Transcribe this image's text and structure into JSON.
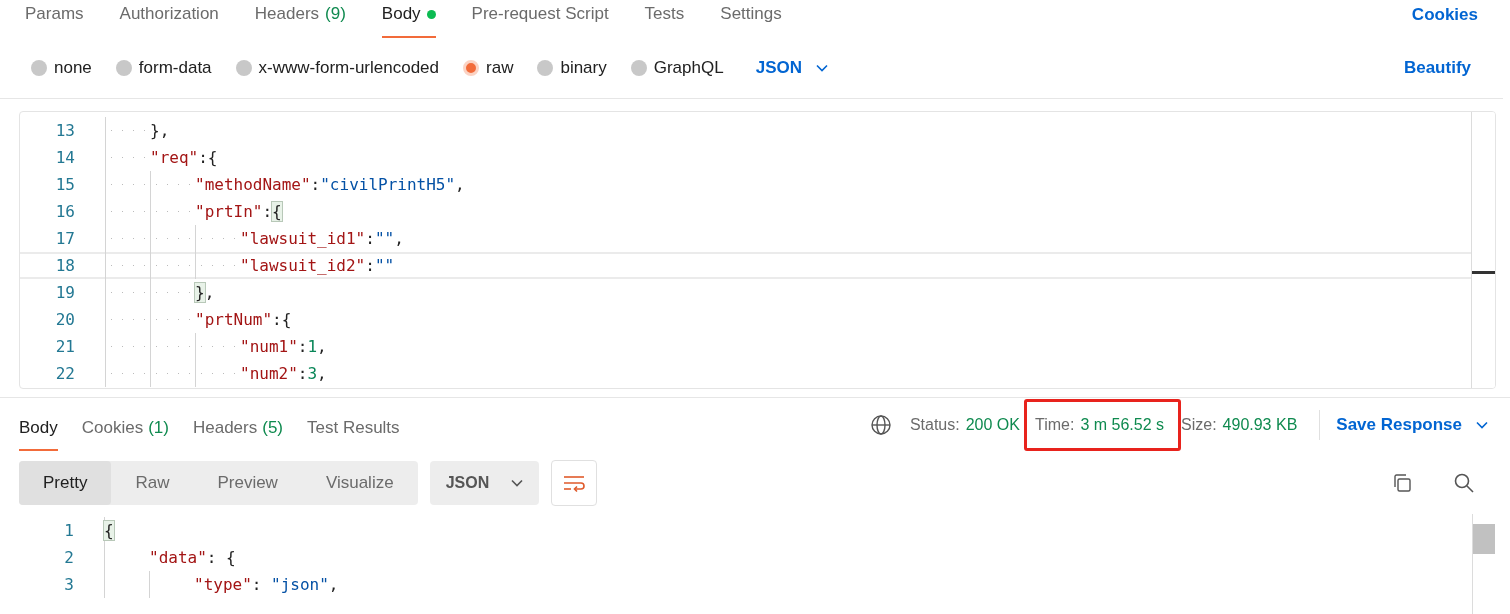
{
  "request_tabs": [
    {
      "label": "Params",
      "selected": false
    },
    {
      "label": "Authorization",
      "selected": false
    },
    {
      "label": "Headers",
      "count": "(9)",
      "selected": false
    },
    {
      "label": "Body",
      "selected": true,
      "indicator": true
    },
    {
      "label": "Pre-request Script",
      "selected": false
    },
    {
      "label": "Tests",
      "selected": false
    },
    {
      "label": "Settings",
      "selected": false
    }
  ],
  "cookies_link": "Cookies",
  "body_types": [
    {
      "label": "none",
      "selected": false
    },
    {
      "label": "form-data",
      "selected": false
    },
    {
      "label": "x-www-form-urlencoded",
      "selected": false
    },
    {
      "label": "raw",
      "selected": true
    },
    {
      "label": "binary",
      "selected": false
    },
    {
      "label": "GraphQL",
      "selected": false
    }
  ],
  "raw_format": "JSON",
  "beautify_link": "Beautify",
  "request_editor": {
    "lines": [
      {
        "number": "13",
        "tokens": [
          {
            "kind": "punct",
            "text": "},"
          }
        ]
      },
      {
        "number": "14",
        "tokens": [
          {
            "kind": "key",
            "text": "\"req\""
          },
          {
            "kind": "punct",
            "text": ":{"
          }
        ],
        "children": [
          {
            "number": "15",
            "tokens": [
              {
                "kind": "key",
                "text": "\"methodName\""
              },
              {
                "kind": "punct",
                "text": ":"
              },
              {
                "kind": "str",
                "text": "\"civilPrintH5\""
              },
              {
                "kind": "punct",
                "text": ","
              }
            ]
          },
          {
            "number": "16",
            "tokens": [
              {
                "kind": "key",
                "text": "\"prtIn\""
              },
              {
                "kind": "punct",
                "text": ":"
              },
              {
                "kind": "match",
                "text": "{"
              }
            ],
            "children": [
              {
                "number": "17",
                "tokens": [
                  {
                    "kind": "key",
                    "text": "\"lawsuit_id1\""
                  },
                  {
                    "kind": "punct",
                    "text": ":"
                  },
                  {
                    "kind": "str",
                    "text": "\"\""
                  },
                  {
                    "kind": "punct",
                    "text": ","
                  }
                ]
              },
              {
                "number": "18",
                "current": true,
                "tokens": [
                  {
                    "kind": "key",
                    "text": "\"lawsuit_id2\""
                  },
                  {
                    "kind": "punct",
                    "text": ":"
                  },
                  {
                    "kind": "str",
                    "text": "\"\""
                  }
                ]
              }
            ]
          },
          {
            "number": "19",
            "tokens": [
              {
                "kind": "match",
                "text": "}"
              },
              {
                "kind": "punct",
                "text": ","
              }
            ]
          },
          {
            "number": "20",
            "tokens": [
              {
                "kind": "key",
                "text": "\"prtNum\""
              },
              {
                "kind": "punct",
                "text": ":{"
              }
            ],
            "children": [
              {
                "number": "21",
                "tokens": [
                  {
                    "kind": "key",
                    "text": "\"num1\""
                  },
                  {
                    "kind": "punct",
                    "text": ":"
                  },
                  {
                    "kind": "num",
                    "text": "1"
                  },
                  {
                    "kind": "punct",
                    "text": ","
                  }
                ]
              },
              {
                "number": "22",
                "tokens": [
                  {
                    "kind": "key",
                    "text": "\"num2\""
                  },
                  {
                    "kind": "punct",
                    "text": ":"
                  },
                  {
                    "kind": "num",
                    "text": "3"
                  },
                  {
                    "kind": "punct",
                    "text": ","
                  }
                ]
              }
            ]
          }
        ]
      }
    ]
  },
  "response_tabs": [
    {
      "label": "Body",
      "selected": true
    },
    {
      "label": "Cookies",
      "count": "(1)",
      "selected": false
    },
    {
      "label": "Headers",
      "count": "(5)",
      "selected": false
    },
    {
      "label": "Test Results",
      "selected": false
    }
  ],
  "response_stats": [
    {
      "label": "Status:",
      "value": "200 OK",
      "highlighted": false
    },
    {
      "label": "Time:",
      "value": "3 m 56.52 s",
      "highlighted": true
    },
    {
      "label": "Size:",
      "value": "490.93 KB",
      "highlighted": false
    }
  ],
  "save_response": "Save Response",
  "view_modes": [
    {
      "label": "Pretty",
      "selected": true
    },
    {
      "label": "Raw",
      "selected": false
    },
    {
      "label": "Preview",
      "selected": false
    },
    {
      "label": "Visualize",
      "selected": false
    }
  ],
  "response_format": "JSON",
  "response_editor": {
    "lines": [
      {
        "number": "1",
        "tokens": [
          {
            "kind": "match",
            "text": "{"
          }
        ],
        "children": [
          {
            "number": "2",
            "tokens": [
              {
                "kind": "key",
                "text": "\"data\""
              },
              {
                "kind": "punct",
                "text": ": {"
              }
            ],
            "children": [
              {
                "number": "3",
                "tokens": [
                  {
                    "kind": "key",
                    "text": "\"type\""
                  },
                  {
                    "kind": "punct",
                    "text": ": "
                  },
                  {
                    "kind": "str",
                    "text": "\"json\""
                  },
                  {
                    "kind": "punct",
                    "text": ","
                  }
                ]
              }
            ]
          }
        ]
      }
    ]
  }
}
